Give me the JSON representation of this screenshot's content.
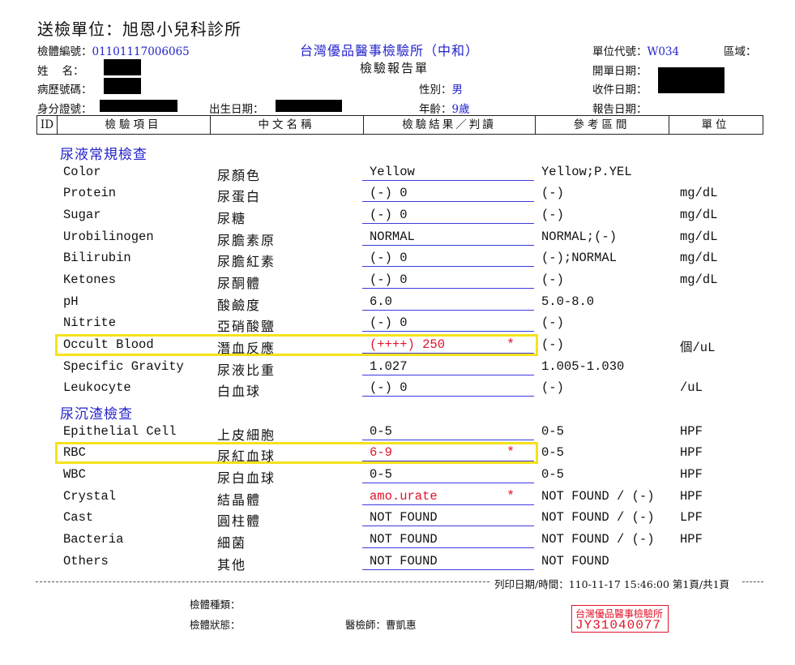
{
  "header": {
    "title": "送檢單位：旭恩小兒科診所",
    "specimen_no_label": "檢體編號：",
    "specimen_no": "01101117006065",
    "lab_name": "台灣優品醫事檢驗所（中和）",
    "unit_code_label": "單位代號：",
    "unit_code": "W034",
    "area_label": "區域：",
    "name_label": "姓    名：",
    "report_title": "檢驗報告單",
    "open_date_label": "開單日期：",
    "record_no_label": "病歷號碼：",
    "sex_label": "性別：",
    "sex": "男",
    "receive_date_label": "收件日期：",
    "id_label": "身分證號：",
    "birth_label": "出生日期：",
    "age_label": "年齡：",
    "age": "9歲",
    "report_date_label": "報告日期："
  },
  "columns": {
    "id": "ID",
    "item": "檢驗項目",
    "name_zh": "中文名稱",
    "result": "檢驗結果／判讀",
    "reference": "參考區間",
    "unit": "單位"
  },
  "sections": {
    "urine": "尿液常規檢查",
    "sediment": "尿沉渣檢查"
  },
  "rows": [
    {
      "en": "Color",
      "zh": "尿顏色",
      "result": "Yellow",
      "flag": "",
      "ref": "Yellow;P.YEL",
      "unit": ""
    },
    {
      "en": "Protein",
      "zh": "尿蛋白",
      "result": "(-) 0",
      "flag": "",
      "ref": "(-)",
      "unit": "mg/dL"
    },
    {
      "en": "Sugar",
      "zh": "尿糖",
      "result": "(-) 0",
      "flag": "",
      "ref": "(-)",
      "unit": "mg/dL"
    },
    {
      "en": "Urobilinogen",
      "zh": "尿膽素原",
      "result": "NORMAL",
      "flag": "",
      "ref": "NORMAL;(-)",
      "unit": "mg/dL"
    },
    {
      "en": "Bilirubin",
      "zh": "尿膽紅素",
      "result": "(-) 0",
      "flag": "",
      "ref": "(-);NORMAL",
      "unit": "mg/dL"
    },
    {
      "en": "Ketones",
      "zh": "尿酮體",
      "result": "(-) 0",
      "flag": "",
      "ref": "(-)",
      "unit": "mg/dL"
    },
    {
      "en": "pH",
      "zh": "酸鹼度",
      "result": "6.0",
      "flag": "",
      "ref": "5.0-8.0",
      "unit": ""
    },
    {
      "en": "Nitrite",
      "zh": "亞硝酸鹽",
      "result": "(-) 0",
      "flag": "",
      "ref": "(-)",
      "unit": ""
    },
    {
      "en": "Occult Blood",
      "zh": "潛血反應",
      "result": "(++++) 250",
      "flag": "*",
      "ref": "(-)",
      "unit": "個/uL"
    },
    {
      "en": "Specific Gravity",
      "zh": "尿液比重",
      "result": "1.027",
      "flag": "",
      "ref": "1.005-1.030",
      "unit": ""
    },
    {
      "en": "Leukocyte",
      "zh": "白血球",
      "result": "(-) 0",
      "flag": "",
      "ref": "(-)",
      "unit": "/uL"
    },
    {
      "en": "Epithelial Cell",
      "zh": "上皮細胞",
      "result": "0-5",
      "flag": "",
      "ref": "0-5",
      "unit": "HPF"
    },
    {
      "en": "RBC",
      "zh": "尿紅血球",
      "result": "6-9",
      "flag": "*",
      "ref": "0-5",
      "unit": "HPF"
    },
    {
      "en": "WBC",
      "zh": "尿白血球",
      "result": "0-5",
      "flag": "",
      "ref": "0-5",
      "unit": "HPF"
    },
    {
      "en": "Crystal",
      "zh": "結晶體",
      "result": "amo.urate",
      "flag": "*",
      "ref": "NOT FOUND / (-)",
      "unit": "HPF"
    },
    {
      "en": "Cast",
      "zh": "圓柱體",
      "result": "NOT FOUND",
      "flag": "",
      "ref": "NOT FOUND / (-)",
      "unit": "LPF"
    },
    {
      "en": "Bacteria",
      "zh": "細菌",
      "result": "NOT FOUND",
      "flag": "",
      "ref": "NOT FOUND / (-)",
      "unit": "HPF"
    },
    {
      "en": "Others",
      "zh": "其他",
      "result": "NOT FOUND",
      "flag": "",
      "ref": "NOT FOUND",
      "unit": ""
    }
  ],
  "footer": {
    "print_info": "列印日期/時間：110-11-17 15:46:00 第1頁/共1頁",
    "specimen_type_label": "檢體種類：",
    "specimen_state_label": "檢體狀態：",
    "technician": "醫檢師：曹凱惠",
    "seal_line1": "台灣優品醫事檢驗所",
    "seal_line2": "JY31040077"
  },
  "colors": {
    "accent_blue": "#2222cc",
    "abnormal_red": "#e0142a",
    "highlight_yellow": "#f5e21b"
  }
}
